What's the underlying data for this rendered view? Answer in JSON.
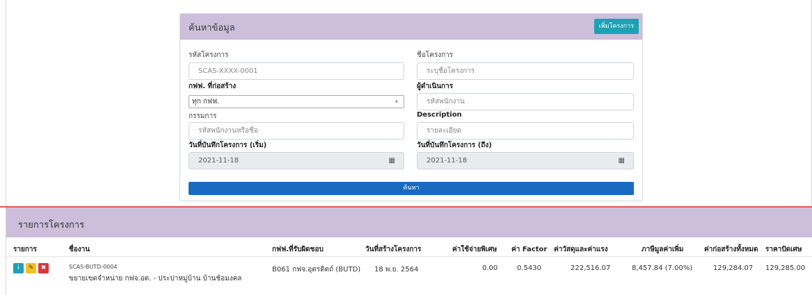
{
  "search": {
    "title": "ค้นหาข้อมูล",
    "add_button": "เพิ่มโครงการ",
    "project_code_label": "รหัสโครงการ",
    "project_code_placeholder": "SCAS-XXXX-0001",
    "project_name_label": "ชื่อโครงการ",
    "project_name_placeholder": "ระบุชื่อโครงการ",
    "pea_label": "กฟฟ. ที่ก่อสร้าง",
    "pea_selected": "ทุก กฟฟ.",
    "operator_label": "ผู้ดำเนินการ",
    "operator_placeholder": "รหัสพนักงาน",
    "committee_label": "กรรมการ",
    "committee_placeholder": "รหัสพนักงานหรือชื่อ",
    "description_label": "Description",
    "description_placeholder": "รายละเอียด",
    "date_from_label": "วันที่บันทึกโครงการ (เริ่ม)",
    "date_from_value": "2021-11-18",
    "date_to_label": "วันที่บันทึกโครงการ (ถึง)",
    "date_to_value": "2021-11-18",
    "search_button": "ค้นหา"
  },
  "list": {
    "title": "รายการโครงการ",
    "columns": [
      "รายการ",
      "ชื่องาน",
      "กฟฟ.ที่รับผิดชอบ",
      "วันที่สร้างโครงการ",
      "ค่าใช้จ่ายพิเศษ",
      "ค่า Factor",
      "ค่าวัสดุและค่าแรง",
      "ภาษีมูลค่าเพิ่ม",
      "ค่าก่อสร้างทั้งหมด",
      "ราคาปัดเศษ"
    ],
    "rows": [
      {
        "code": "SCAS-BUTD-0004",
        "name": "ขยายเขตจำหน่าย กฟจ.อต. - ประปาหมู่บ้าน บ้านช้อมงคล",
        "pea": "B061 กฟจ.อุตรดิตถ์ (BUTD)",
        "created": "18 พ.ย. 2564",
        "special_cost": "0.00",
        "factor": "0.5430",
        "material_labor": "222,516.07",
        "vat": "8,457.84 (7.00%)",
        "total": "129,284.07",
        "rounded": "129,285.00"
      }
    ]
  },
  "icons": {
    "info": "info-icon",
    "edit": "edit-icon",
    "delete": "trash-icon",
    "calendar": "calendar-icon",
    "dropdown": "chevron-down-icon"
  },
  "colors": {
    "panel_header": "#cdbfdb",
    "add_button": "#1ba2b5",
    "search_button": "#1a6ac1",
    "divider": "#e0585c",
    "info": "#1ba2b5",
    "edit": "#f4c020",
    "delete": "#d9363e"
  }
}
